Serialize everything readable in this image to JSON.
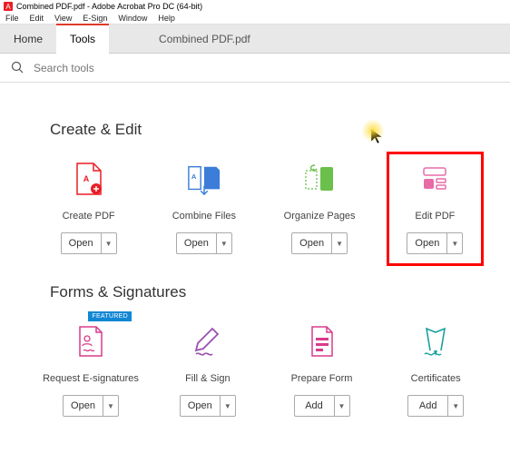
{
  "window": {
    "title": "Combined PDF.pdf - Adobe Acrobat Pro DC (64-bit)"
  },
  "menu": {
    "file": "File",
    "edit": "Edit",
    "view": "View",
    "esign": "E-Sign",
    "window": "Window",
    "help": "Help"
  },
  "tabs": {
    "home": "Home",
    "tools": "Tools",
    "doc": "Combined PDF.pdf"
  },
  "search": {
    "placeholder": "Search tools"
  },
  "sections": {
    "create_edit": "Create & Edit",
    "forms_sigs": "Forms & Signatures"
  },
  "tools": {
    "create_pdf": {
      "label": "Create PDF",
      "btn": "Open"
    },
    "combine_files": {
      "label": "Combine Files",
      "btn": "Open"
    },
    "organize_pages": {
      "label": "Organize Pages",
      "btn": "Open"
    },
    "edit_pdf": {
      "label": "Edit PDF",
      "btn": "Open"
    },
    "request_esig": {
      "label": "Request E-signatures",
      "btn": "Open",
      "badge": "FEATURED"
    },
    "fill_sign": {
      "label": "Fill & Sign",
      "btn": "Open"
    },
    "prepare_form": {
      "label": "Prepare Form",
      "btn": "Add"
    },
    "certificates": {
      "label": "Certificates",
      "btn": "Add"
    }
  },
  "colors": {
    "red": "#ec1c24",
    "blue": "#3b7dd8",
    "green": "#6bc04b",
    "pink": "#e86ba8",
    "purple": "#9b4fb3",
    "magenta": "#d93b8a",
    "teal": "#1aa0a0"
  }
}
